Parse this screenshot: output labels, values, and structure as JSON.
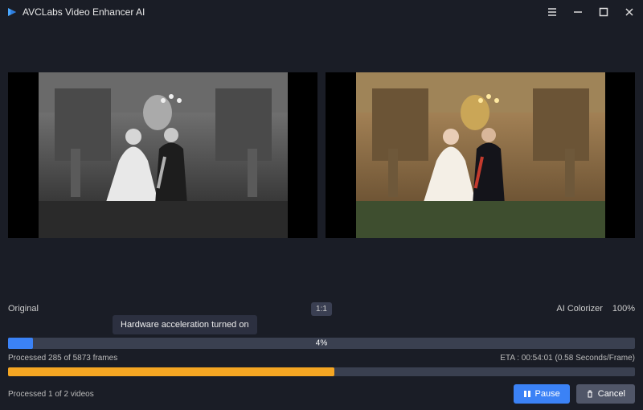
{
  "app": {
    "title": "AVCLabs Video Enhancer AI"
  },
  "compare": {
    "left_label": "Original",
    "aspect": "1:1",
    "right_label": "AI Colorizer",
    "zoom": "100%"
  },
  "tooltip": "Hardware acceleration turned on",
  "progress": {
    "frame_percent": "4%",
    "frame_percent_value": 4,
    "frames_done": 285,
    "frames_total": 5873,
    "frames_status": "Processed 285 of 5873 frames",
    "eta_label": "ETA :",
    "eta_time": "00:54:01",
    "seconds_per_frame": "(0.58 Seconds/Frame)",
    "video_percent_value": 52,
    "videos_done": 1,
    "videos_total": 2,
    "videos_status": "Processed 1 of 2 videos"
  },
  "buttons": {
    "pause": "Pause",
    "cancel": "Cancel"
  },
  "colors": {
    "accent_blue": "#3b82f6",
    "accent_orange": "#f5a623",
    "bar_track": "#3a4050"
  }
}
